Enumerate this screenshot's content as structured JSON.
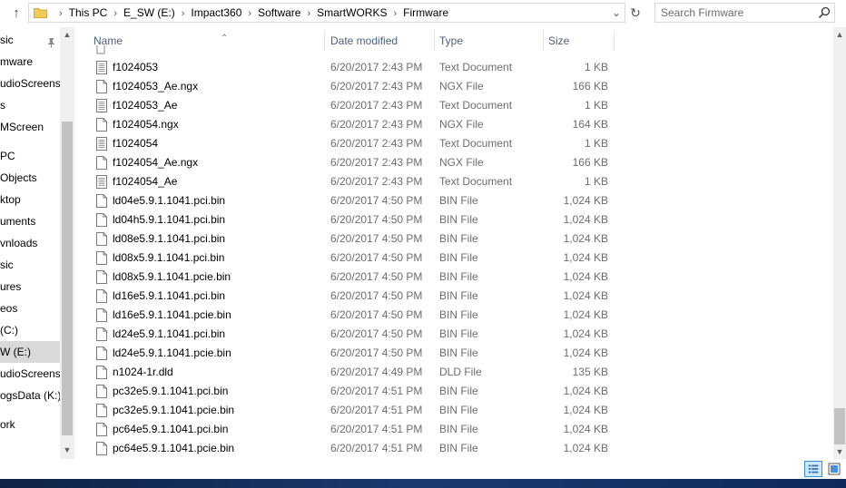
{
  "address": {
    "crumbs": [
      "This PC",
      "E_SW (E:)",
      "Impact360",
      "Software",
      "SmartWORKS",
      "Firmware"
    ]
  },
  "search": {
    "placeholder": "Search Firmware"
  },
  "nav": {
    "items": [
      {
        "label": "sic",
        "pinned": true
      },
      {
        "label": "mware"
      },
      {
        "label": "udioScreens"
      },
      {
        "label": "s"
      },
      {
        "label": "MScreen"
      },
      {
        "label": "PC"
      },
      {
        "label": "Objects"
      },
      {
        "label": "ktop"
      },
      {
        "label": "uments"
      },
      {
        "label": "vnloads"
      },
      {
        "label": "sic"
      },
      {
        "label": "ures"
      },
      {
        "label": "eos"
      },
      {
        "label": "(C:)"
      },
      {
        "label": "W (E:)",
        "selected": true
      },
      {
        "label": "udioScreens"
      },
      {
        "label": "ogsData (K:)"
      },
      {
        "label": "ork"
      }
    ]
  },
  "columns": {
    "name": "Name",
    "date": "Date modified",
    "type": "Type",
    "size": "Size"
  },
  "files": [
    {
      "name": "f1024053",
      "date": "6/20/2017 2:43 PM",
      "type": "Text Document",
      "size": "1 KB",
      "icon": "text-file-icon"
    },
    {
      "name": "f1024053_Ae.ngx",
      "date": "6/20/2017 2:43 PM",
      "type": "NGX File",
      "size": "166 KB",
      "icon": "file-icon"
    },
    {
      "name": "f1024053_Ae",
      "date": "6/20/2017 2:43 PM",
      "type": "Text Document",
      "size": "1 KB",
      "icon": "text-file-icon"
    },
    {
      "name": "f1024054.ngx",
      "date": "6/20/2017 2:43 PM",
      "type": "NGX File",
      "size": "164 KB",
      "icon": "file-icon"
    },
    {
      "name": "f1024054",
      "date": "6/20/2017 2:43 PM",
      "type": "Text Document",
      "size": "1 KB",
      "icon": "text-file-icon"
    },
    {
      "name": "f1024054_Ae.ngx",
      "date": "6/20/2017 2:43 PM",
      "type": "NGX File",
      "size": "166 KB",
      "icon": "file-icon"
    },
    {
      "name": "f1024054_Ae",
      "date": "6/20/2017 2:43 PM",
      "type": "Text Document",
      "size": "1 KB",
      "icon": "text-file-icon"
    },
    {
      "name": "ld04e5.9.1.1041.pci.bin",
      "date": "6/20/2017 4:50 PM",
      "type": "BIN File",
      "size": "1,024 KB",
      "icon": "file-icon"
    },
    {
      "name": "ld04h5.9.1.1041.pci.bin",
      "date": "6/20/2017 4:50 PM",
      "type": "BIN File",
      "size": "1,024 KB",
      "icon": "file-icon"
    },
    {
      "name": "ld08e5.9.1.1041.pci.bin",
      "date": "6/20/2017 4:50 PM",
      "type": "BIN File",
      "size": "1,024 KB",
      "icon": "file-icon"
    },
    {
      "name": "ld08x5.9.1.1041.pci.bin",
      "date": "6/20/2017 4:50 PM",
      "type": "BIN File",
      "size": "1,024 KB",
      "icon": "file-icon"
    },
    {
      "name": "ld08x5.9.1.1041.pcie.bin",
      "date": "6/20/2017 4:50 PM",
      "type": "BIN File",
      "size": "1,024 KB",
      "icon": "file-icon"
    },
    {
      "name": "ld16e5.9.1.1041.pci.bin",
      "date": "6/20/2017 4:50 PM",
      "type": "BIN File",
      "size": "1,024 KB",
      "icon": "file-icon"
    },
    {
      "name": "ld16e5.9.1.1041.pcie.bin",
      "date": "6/20/2017 4:50 PM",
      "type": "BIN File",
      "size": "1,024 KB",
      "icon": "file-icon"
    },
    {
      "name": "ld24e5.9.1.1041.pci.bin",
      "date": "6/20/2017 4:50 PM",
      "type": "BIN File",
      "size": "1,024 KB",
      "icon": "file-icon"
    },
    {
      "name": "ld24e5.9.1.1041.pcie.bin",
      "date": "6/20/2017 4:50 PM",
      "type": "BIN File",
      "size": "1,024 KB",
      "icon": "file-icon"
    },
    {
      "name": "n1024-1r.dld",
      "date": "6/20/2017 4:49 PM",
      "type": "DLD File",
      "size": "135 KB",
      "icon": "file-icon"
    },
    {
      "name": "pc32e5.9.1.1041.pci.bin",
      "date": "6/20/2017 4:51 PM",
      "type": "BIN File",
      "size": "1,024 KB",
      "icon": "file-icon"
    },
    {
      "name": "pc32e5.9.1.1041.pcie.bin",
      "date": "6/20/2017 4:51 PM",
      "type": "BIN File",
      "size": "1,024 KB",
      "icon": "file-icon"
    },
    {
      "name": "pc64e5.9.1.1041.pci.bin",
      "date": "6/20/2017 4:51 PM",
      "type": "BIN File",
      "size": "1,024 KB",
      "icon": "file-icon"
    },
    {
      "name": "pc64e5.9.1.1041.pcie.bin",
      "date": "6/20/2017 4:51 PM",
      "type": "BIN File",
      "size": "1,024 KB",
      "icon": "file-icon"
    }
  ],
  "colors": {
    "header_text": "#4c607a",
    "secondary_text": "#6d6d6d",
    "selection": "#cce8ff",
    "folder": "#f3cb5a"
  }
}
